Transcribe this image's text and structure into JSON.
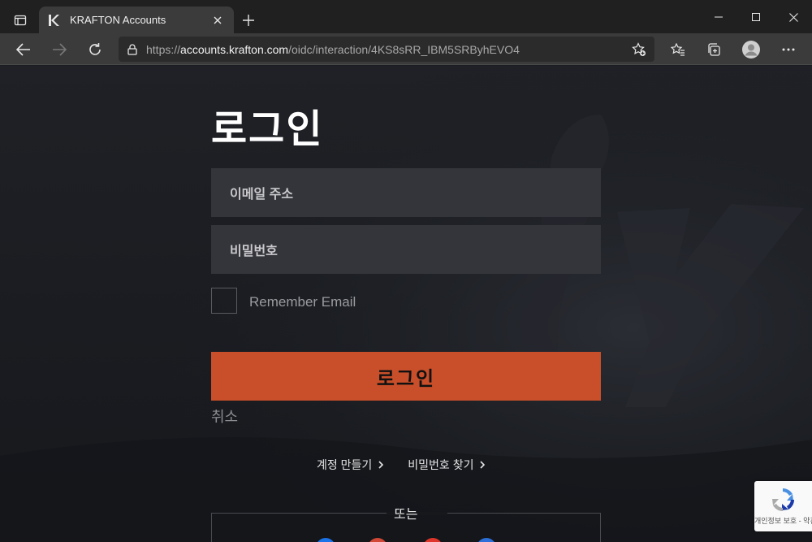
{
  "browser": {
    "tab_title": "KRAFTON Accounts",
    "url_prefix": "https://",
    "url_host": "accounts.krafton.com",
    "url_path": "/oidc/interaction/4KS8sRR_IBM5SRByhEVO4"
  },
  "login": {
    "heading": "로그인",
    "email_placeholder": "이메일 주소",
    "password_placeholder": "비밀번호",
    "remember_label": "Remember Email",
    "submit_label": "로그인",
    "cancel_label": "취소",
    "create_account_label": "계정 만들기",
    "find_password_label": "비밀번호 찾기",
    "or_label": "또는"
  },
  "recaptcha": {
    "text": "개인정보 보호 - 약관"
  },
  "colors": {
    "accent": "#c84f2a",
    "field_bg": "#34353a",
    "page_bg": "#1b1d22"
  }
}
